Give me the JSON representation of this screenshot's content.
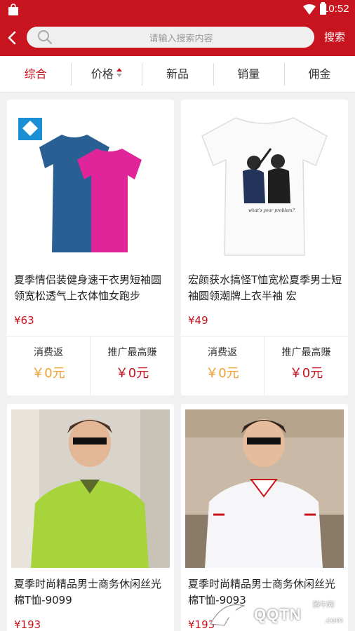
{
  "status_bar": {
    "time": "10:52"
  },
  "header": {
    "search_placeholder": "请输入搜索内容",
    "search_button": "搜索"
  },
  "sort_tabs": [
    {
      "label": "综合",
      "active": true
    },
    {
      "label": "价格"
    },
    {
      "label": "新品"
    },
    {
      "label": "销量"
    },
    {
      "label": "佣金"
    }
  ],
  "products": [
    {
      "title": "夏季情侣装健身速干衣男短袖圆领宽松透气上衣体恤女跑步",
      "price": "¥63",
      "rebate_label": "消费返",
      "rebate_value": "￥0元",
      "earn_label": "推广最高赚",
      "earn_value": "￥0元"
    },
    {
      "title": "宏颜获水搞怪T恤宽松夏季男士短袖圆领潮牌上衣半袖 宏",
      "price": "¥49",
      "rebate_label": "消费返",
      "rebate_value": "￥0元",
      "earn_label": "推广最高赚",
      "earn_value": "￥0元",
      "image_caption": "what's your problem?"
    },
    {
      "title": "夏季时尚精品男士商务休闲丝光棉T恤-9099",
      "price": "¥193"
    },
    {
      "title": "夏季时尚精品男士商务休闲丝光棉T恤-9093",
      "price": "¥193"
    }
  ],
  "watermark": {
    "text": "QQTN",
    "sub": "腾牛网",
    "sub2": ".com"
  },
  "colors": {
    "brand_red": "#c8141e",
    "rebate_orange": "#f0a030"
  }
}
